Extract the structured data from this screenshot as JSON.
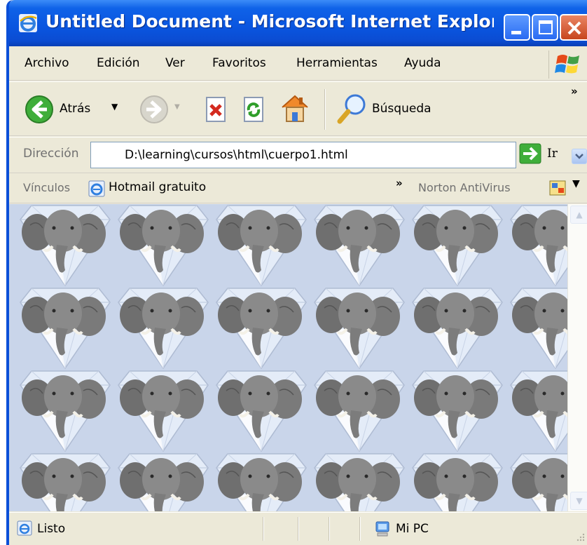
{
  "window": {
    "title": "Untitled Document - Microsoft Internet Explorer ..."
  },
  "menu": {
    "items": [
      "Archivo",
      "Edición",
      "Ver",
      "Favoritos",
      "Herramientas",
      "Ayuda"
    ]
  },
  "toolbar": {
    "back_label": "Atrás",
    "search_label": "Búsqueda",
    "overflow": "»"
  },
  "address": {
    "label": "Dirección",
    "value": "D:\\learning\\cursos\\html\\cuerpo1.html",
    "go_label": "Ir"
  },
  "links": {
    "label": "Vínculos",
    "items": [
      "Hotmail gratuito"
    ],
    "overflow": "»",
    "norton_label": "Norton AntiVirus"
  },
  "content": {
    "background_color": "#c9d5ea",
    "tile_image": "elephant-in-diamond"
  },
  "status": {
    "text": "Listo",
    "zone": "Mi PC"
  },
  "colors": {
    "titlebar": "#0a55df",
    "chrome": "#ece9d8",
    "close_button": "#c8461e"
  }
}
